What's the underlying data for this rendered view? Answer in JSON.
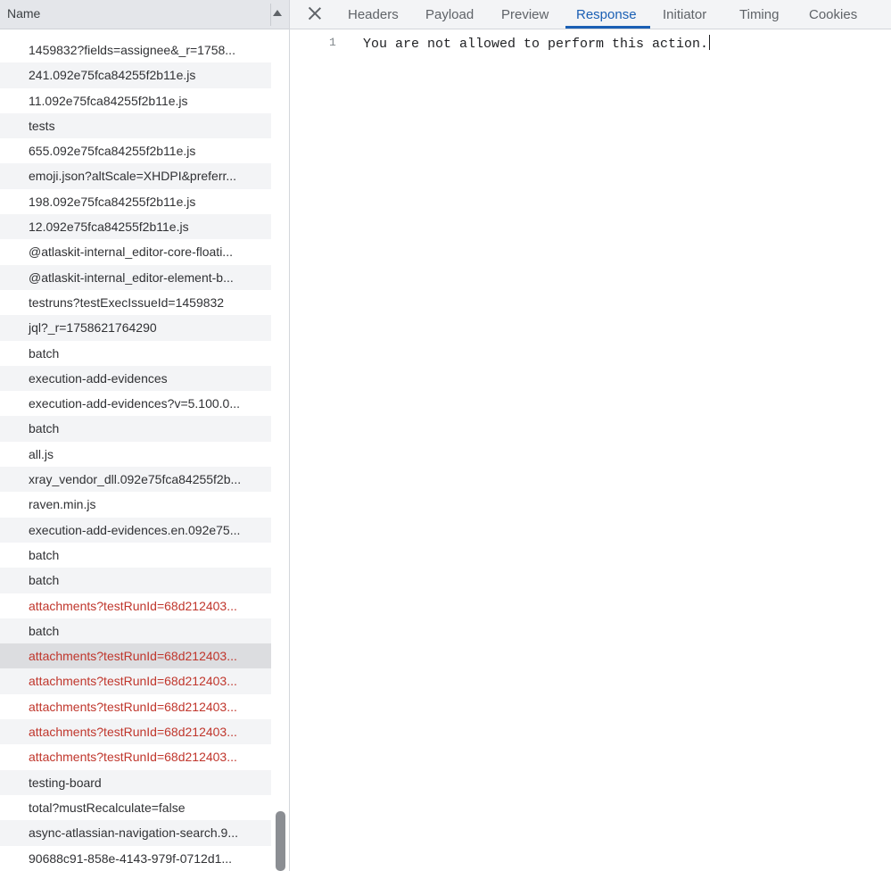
{
  "network_list": {
    "header": "Name",
    "rows": [
      {
        "name": "1459832?fields=assignee&_r=1758...",
        "error": false
      },
      {
        "name": "241.092e75fca84255f2b11e.js",
        "error": false
      },
      {
        "name": "11.092e75fca84255f2b11e.js",
        "error": false
      },
      {
        "name": "tests",
        "error": false
      },
      {
        "name": "655.092e75fca84255f2b11e.js",
        "error": false
      },
      {
        "name": "emoji.json?altScale=XHDPI&preferr...",
        "error": false
      },
      {
        "name": "198.092e75fca84255f2b11e.js",
        "error": false
      },
      {
        "name": "12.092e75fca84255f2b11e.js",
        "error": false
      },
      {
        "name": "@atlaskit-internal_editor-core-floati...",
        "error": false
      },
      {
        "name": "@atlaskit-internal_editor-element-b...",
        "error": false
      },
      {
        "name": "testruns?testExecIssueId=1459832",
        "error": false
      },
      {
        "name": "jql?_r=1758621764290",
        "error": false
      },
      {
        "name": "batch",
        "error": false
      },
      {
        "name": "execution-add-evidences",
        "error": false
      },
      {
        "name": "execution-add-evidences?v=5.100.0...",
        "error": false
      },
      {
        "name": "batch",
        "error": false
      },
      {
        "name": "all.js",
        "error": false
      },
      {
        "name": "xray_vendor_dll.092e75fca84255f2b...",
        "error": false
      },
      {
        "name": "raven.min.js",
        "error": false
      },
      {
        "name": "execution-add-evidences.en.092e75...",
        "error": false
      },
      {
        "name": "batch",
        "error": false
      },
      {
        "name": "batch",
        "error": false
      },
      {
        "name": "attachments?testRunId=68d212403...",
        "error": true
      },
      {
        "name": "batch",
        "error": false
      },
      {
        "name": "attachments?testRunId=68d212403...",
        "error": true,
        "selected": true
      },
      {
        "name": "attachments?testRunId=68d212403...",
        "error": true
      },
      {
        "name": "attachments?testRunId=68d212403...",
        "error": true
      },
      {
        "name": "attachments?testRunId=68d212403...",
        "error": true
      },
      {
        "name": "attachments?testRunId=68d212403...",
        "error": true
      },
      {
        "name": "testing-board",
        "error": false
      },
      {
        "name": "total?mustRecalculate=false",
        "error": false
      },
      {
        "name": "async-atlassian-navigation-search.9...",
        "error": false
      },
      {
        "name": "90688c91-858e-4143-979f-0712d1...",
        "error": false
      }
    ]
  },
  "detail_panel": {
    "tabs": [
      "Headers",
      "Payload",
      "Preview",
      "Response",
      "Initiator",
      "Timing",
      "Cookies"
    ],
    "active_tab": "Response",
    "response": {
      "line_number": "1",
      "line_text": "You are not allowed to perform this action."
    }
  },
  "colors": {
    "error_text": "#c0362c",
    "active_tab": "#1a5fb4",
    "selected_row": "#dcdde0"
  },
  "icons": {
    "close": "close-icon",
    "sort": "sort-ascending-icon"
  }
}
